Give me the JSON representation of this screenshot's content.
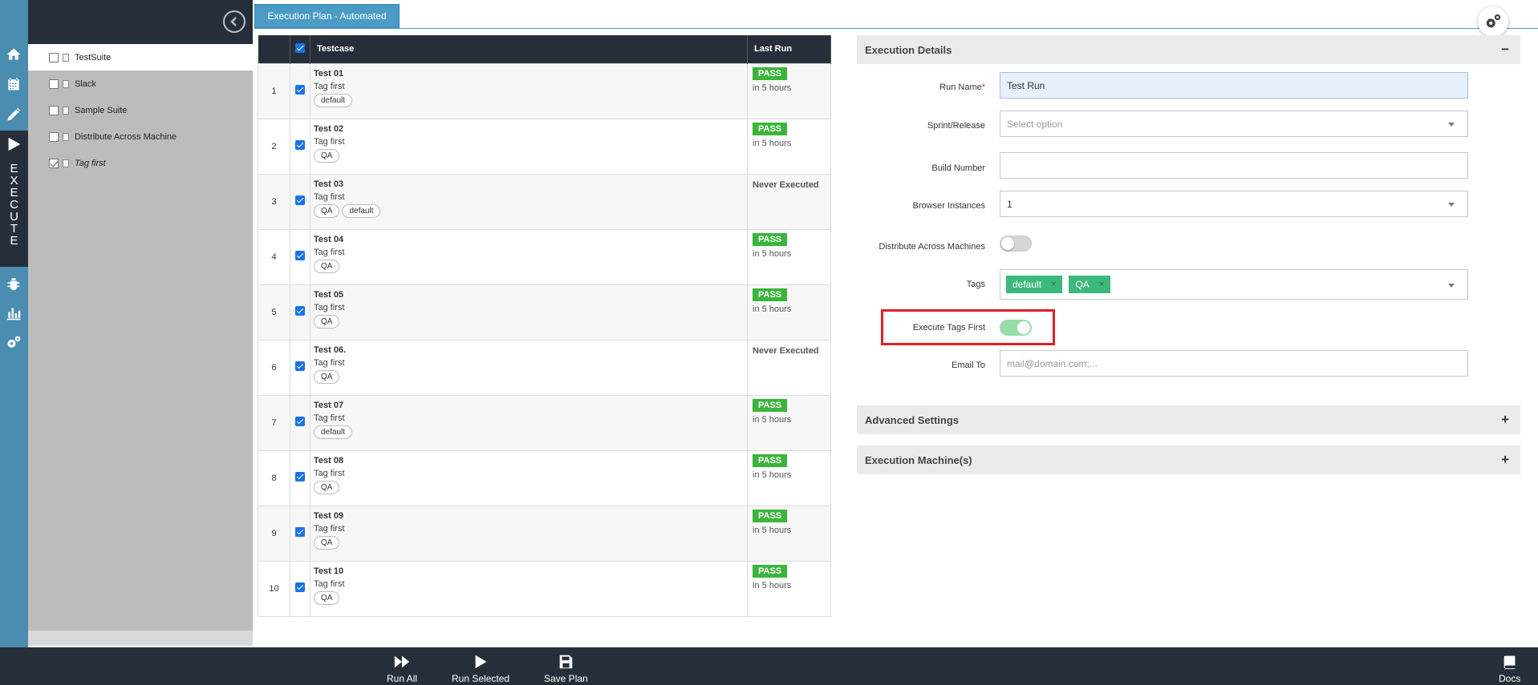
{
  "rail": {
    "icons": [
      "home-icon",
      "calendar-icon",
      "pencil-icon",
      "play-icon",
      "bug-icon",
      "bar-chart-icon",
      "gears-icon"
    ],
    "active_section": [
      "E",
      "X",
      "E",
      "C",
      "U",
      "T",
      "E"
    ]
  },
  "tree": {
    "items": [
      {
        "label": "TestSuite",
        "checked": false,
        "active": true,
        "italic": false
      },
      {
        "label": "Slack",
        "checked": false,
        "active": false,
        "italic": false
      },
      {
        "label": "Sample Suite",
        "checked": false,
        "active": false,
        "italic": false
      },
      {
        "label": "Distribute Across Machine",
        "checked": false,
        "active": false,
        "italic": false
      },
      {
        "label": "Tag first",
        "checked": true,
        "active": false,
        "italic": true
      }
    ]
  },
  "tab": {
    "label": "Execution Plan - Automated"
  },
  "table": {
    "headers": {
      "testcase": "Testcase",
      "last_run": "Last Run"
    },
    "rows": [
      {
        "num": "1",
        "name": "Test 01",
        "sub": "Tag first",
        "tags": [
          "default"
        ],
        "status": "PASS",
        "when": "in 5 hours"
      },
      {
        "num": "2",
        "name": "Test 02",
        "sub": "Tag first",
        "tags": [
          "QA"
        ],
        "status": "PASS",
        "when": "in 5 hours"
      },
      {
        "num": "3",
        "name": "Test 03",
        "sub": "Tag first",
        "tags": [
          "QA",
          "default"
        ],
        "status": "Never Executed",
        "when": ""
      },
      {
        "num": "4",
        "name": "Test 04",
        "sub": "Tag first",
        "tags": [
          "QA"
        ],
        "status": "PASS",
        "when": "in 5 hours"
      },
      {
        "num": "5",
        "name": "Test 05",
        "sub": "Tag first",
        "tags": [
          "QA"
        ],
        "status": "PASS",
        "when": "in 5 hours"
      },
      {
        "num": "6",
        "name": "Test 06.",
        "sub": "Tag first",
        "tags": [
          "QA"
        ],
        "status": "Never Executed",
        "when": ""
      },
      {
        "num": "7",
        "name": "Test 07",
        "sub": "Tag first",
        "tags": [
          "default"
        ],
        "status": "PASS",
        "when": "in 5 hours"
      },
      {
        "num": "8",
        "name": "Test 08",
        "sub": "Tag first",
        "tags": [
          "QA"
        ],
        "status": "PASS",
        "when": "in 5 hours"
      },
      {
        "num": "9",
        "name": "Test 09",
        "sub": "Tag first",
        "tags": [
          "QA"
        ],
        "status": "PASS",
        "when": "in 5 hours"
      },
      {
        "num": "10",
        "name": "Test 10",
        "sub": "Tag first",
        "tags": [
          "QA"
        ],
        "status": "PASS",
        "when": "in 5 hours"
      }
    ]
  },
  "details": {
    "title": "Execution Details",
    "collapse_symbol": "−",
    "run_name_label": "Run Name",
    "required_mark": "*",
    "run_name_value": "Test Run",
    "sprint_label": "Sprint/Release",
    "sprint_placeholder": "Select option",
    "build_label": "Build Number",
    "build_value": "",
    "browser_label": "Browser Instances",
    "browser_value": "1",
    "distribute_label": "Distribute Across Machines",
    "distribute_on": false,
    "tags_label": "Tags",
    "tags": [
      "default",
      "QA"
    ],
    "tag_remove_symbol": "×",
    "exec_tags_first_label": "Execute Tags First",
    "exec_tags_first_on": true,
    "email_label": "Email To",
    "email_placeholder": "mail@domain.com;..."
  },
  "advanced": {
    "title": "Advanced Settings",
    "expand_symbol": "+"
  },
  "machines": {
    "title": "Execution Machine(s)",
    "expand_symbol": "+"
  },
  "toolbar": {
    "run_all": "Run All",
    "run_selected": "Run Selected",
    "save_plan": "Save Plan",
    "docs": "Docs"
  },
  "colors": {
    "rail": "#4a8db0",
    "dark": "#262f39",
    "pass": "#3ab53a",
    "tag_chip": "#3cb87a",
    "highlight": "#d92127"
  }
}
